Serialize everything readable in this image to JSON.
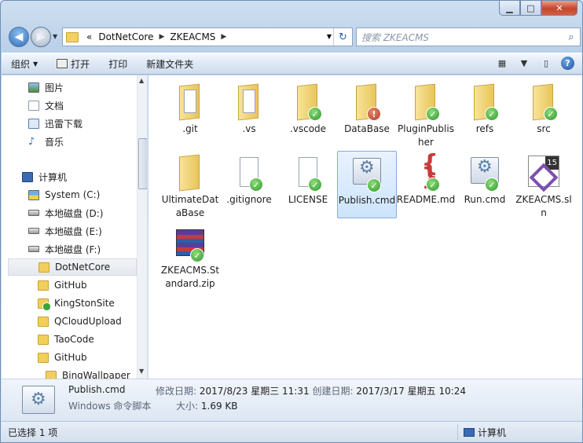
{
  "window": {
    "caption_buttons": [
      "minimize-icon",
      "maximize-icon",
      "close-icon"
    ]
  },
  "address": {
    "overflow": "«",
    "crumbs": [
      "DotNetCore",
      "ZKEACMS"
    ],
    "search_placeholder": "搜索 ZKEACMS"
  },
  "toolbar": {
    "organize": "组织",
    "open": "打开",
    "print": "打印",
    "new_folder": "新建文件夹",
    "help": "?"
  },
  "nav": {
    "libraries": [
      {
        "label": "图片",
        "icon": "pictures-icon"
      },
      {
        "label": "文档",
        "icon": "documents-icon"
      },
      {
        "label": "迅雷下载",
        "icon": "download-icon"
      },
      {
        "label": "音乐",
        "icon": "music-icon"
      }
    ],
    "computer": "计算机",
    "drives": [
      {
        "label": "System (C:)",
        "icon": "system-drive-icon"
      },
      {
        "label": "本地磁盘 (D:)",
        "icon": "drive-icon"
      },
      {
        "label": "本地磁盘 (E:)",
        "icon": "drive-icon"
      },
      {
        "label": "本地磁盘 (F:)",
        "icon": "drive-icon"
      }
    ],
    "folders": [
      {
        "label": "DotNetCore",
        "selected": true
      },
      {
        "label": "GitHub"
      },
      {
        "label": "KingStonSite",
        "synced": true
      },
      {
        "label": "QCloudUpload"
      },
      {
        "label": "TaoCode"
      },
      {
        "label": "GitHub"
      },
      {
        "label": "BingWallpaper"
      }
    ]
  },
  "files": [
    {
      "name": ".git",
      "icon": "folder-icon",
      "badge": ""
    },
    {
      "name": ".vs",
      "icon": "folder-icon",
      "badge": ""
    },
    {
      "name": ".vscode",
      "icon": "folder-icon",
      "badge": "ok"
    },
    {
      "name": "DataBase",
      "icon": "folder-icon",
      "badge": "warn"
    },
    {
      "name": "PluginPublisher",
      "icon": "folder-icon",
      "badge": "ok"
    },
    {
      "name": "refs",
      "icon": "folder-icon",
      "badge": "ok"
    },
    {
      "name": "src",
      "icon": "folder-icon",
      "badge": "ok"
    },
    {
      "name": "UltimateDataBase",
      "icon": "folder-icon",
      "badge": ""
    },
    {
      "name": ".gitignore",
      "icon": "file-icon",
      "badge": "ok"
    },
    {
      "name": "LICENSE",
      "icon": "file-icon",
      "badge": "ok"
    },
    {
      "name": "Publish.cmd",
      "icon": "cmd-icon",
      "badge": "ok",
      "selected": true
    },
    {
      "name": "README.md",
      "icon": "markdown-icon",
      "badge": "ok"
    },
    {
      "name": "Run.cmd",
      "icon": "cmd-icon",
      "badge": "ok"
    },
    {
      "name": "ZKEACMS.sln",
      "icon": "visual-studio-icon",
      "badge": ""
    },
    {
      "name": "ZKEACMS.Standard.zip",
      "icon": "rar-archive-icon",
      "badge": "ok"
    }
  ],
  "details": {
    "name": "Publish.cmd",
    "type": "Windows 命令脚本",
    "modified_label": "修改日期:",
    "modified_value": "2017/8/23 星期三 11:31",
    "created_label": "创建日期:",
    "created_value": "2017/3/17 星期五 10:24",
    "size_label": "大小:",
    "size_value": "1.69 KB"
  },
  "status": {
    "selection": "已选择 1 项",
    "location": "计算机"
  }
}
